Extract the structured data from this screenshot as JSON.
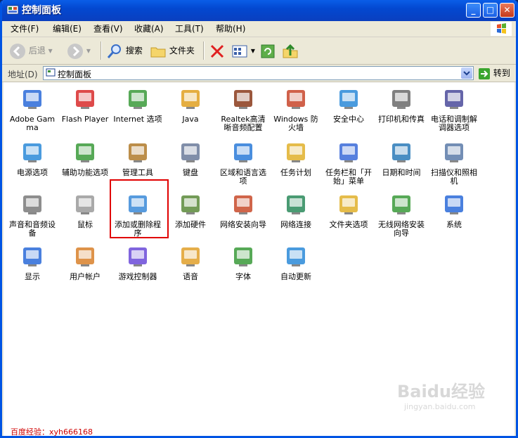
{
  "window": {
    "title": "控制面板"
  },
  "menu": [
    "文件(F)",
    "编辑(E)",
    "查看(V)",
    "收藏(A)",
    "工具(T)",
    "帮助(H)"
  ],
  "toolbar": {
    "back": "后退",
    "search": "搜索",
    "folders": "文件夹"
  },
  "address": {
    "label": "地址(D)",
    "value": "控制面板",
    "go": "转到"
  },
  "items": [
    {
      "label": "Adobe Gamma",
      "icon": "monitor-icon"
    },
    {
      "label": "Flash Player",
      "icon": "flash-icon"
    },
    {
      "label": "Internet 选项",
      "icon": "internet-options-icon"
    },
    {
      "label": "Java",
      "icon": "java-icon"
    },
    {
      "label": "Realtek高清晰音频配置",
      "icon": "speaker-icon"
    },
    {
      "label": "Windows 防火墙",
      "icon": "firewall-icon"
    },
    {
      "label": "安全中心",
      "icon": "shield-icon"
    },
    {
      "label": "打印机和传真",
      "icon": "printer-icon"
    },
    {
      "label": "电话和调制解调器选项",
      "icon": "phone-icon"
    },
    {
      "label": "电源选项",
      "icon": "power-icon"
    },
    {
      "label": "辅助功能选项",
      "icon": "accessibility-icon"
    },
    {
      "label": "管理工具",
      "icon": "admin-tools-icon"
    },
    {
      "label": "键盘",
      "icon": "keyboard-icon"
    },
    {
      "label": "区域和语言选项",
      "icon": "globe-icon"
    },
    {
      "label": "任务计划",
      "icon": "scheduled-tasks-icon"
    },
    {
      "label": "任务栏和「开始」菜单",
      "icon": "taskbar-icon"
    },
    {
      "label": "日期和时间",
      "icon": "clock-icon"
    },
    {
      "label": "扫描仪和照相机",
      "icon": "camera-icon"
    },
    {
      "label": "声音和音频设备",
      "icon": "sound-icon"
    },
    {
      "label": "鼠标",
      "icon": "mouse-icon"
    },
    {
      "label": "添加或删除程序",
      "icon": "add-remove-icon"
    },
    {
      "label": "添加硬件",
      "icon": "hardware-icon"
    },
    {
      "label": "网络安装向导",
      "icon": "network-wizard-icon"
    },
    {
      "label": "网络连接",
      "icon": "network-icon"
    },
    {
      "label": "文件夹选项",
      "icon": "folder-options-icon"
    },
    {
      "label": "无线网络安装向导",
      "icon": "wireless-icon"
    },
    {
      "label": "系统",
      "icon": "system-icon"
    },
    {
      "label": "显示",
      "icon": "display-icon"
    },
    {
      "label": "用户帐户",
      "icon": "users-icon"
    },
    {
      "label": "游戏控制器",
      "icon": "gamepad-icon"
    },
    {
      "label": "语音",
      "icon": "speech-icon"
    },
    {
      "label": "字体",
      "icon": "fonts-icon"
    },
    {
      "label": "自动更新",
      "icon": "windows-update-icon"
    }
  ],
  "footer": "百度经验：xyh666168",
  "watermark": {
    "brand": "Baidu经验",
    "url": "jingyan.baidu.com"
  }
}
